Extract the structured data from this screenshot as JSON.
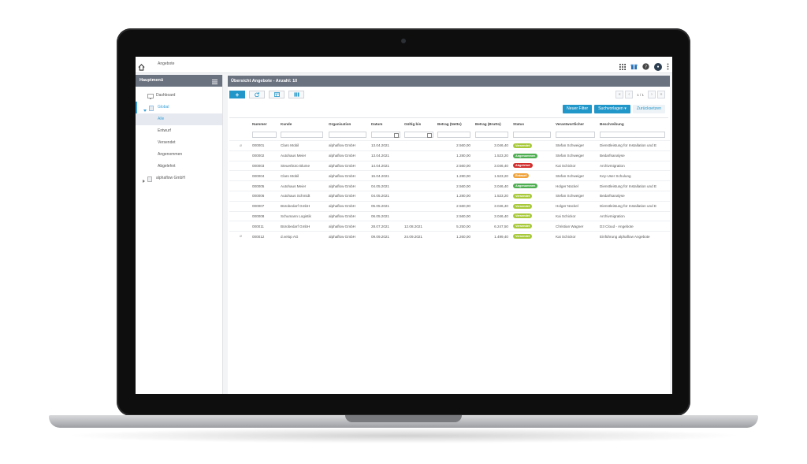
{
  "topbar": {
    "breadcrumb": "Angebote"
  },
  "sidebar": {
    "title": "Hauptmenü",
    "items": [
      {
        "label": "Dashboard",
        "level": 0
      },
      {
        "label": "Global",
        "level": 0
      },
      {
        "label": "Alle",
        "level": 1,
        "active": true
      },
      {
        "label": "Entwurf",
        "level": 1
      },
      {
        "label": "Versendet",
        "level": 1
      },
      {
        "label": "Angenommen",
        "level": 1
      },
      {
        "label": "Abgelehnt",
        "level": 1
      },
      {
        "label": "alphaflow GmbH",
        "level": 0
      }
    ]
  },
  "main": {
    "title": "Übersicht Angebote - Anzahl: 10",
    "pager": {
      "text": "1 / 1"
    },
    "filter_buttons": {
      "new": "Neuer Filter",
      "templates": "Suchvorlagen ▾",
      "reset": "Zurücksetzen"
    }
  },
  "table": {
    "columns": [
      "",
      "Nummer",
      "Kunde",
      "Organisation",
      "Datum",
      "Gültig bis",
      "Betrag (Netto)",
      "Betrag (Brutto)",
      "Status",
      "Verantwortlicher",
      "Beschreibung"
    ],
    "rows": [
      {
        "attach": true,
        "nummer": "000001",
        "kunde": "Claro Mobil",
        "org": "alphaflow GmbH",
        "datum": "13.04.2021",
        "gueltig": "",
        "netto": "2.560,00",
        "brutto": "3.046,40",
        "status": "Versendet",
        "verantw": "Stefan Schweiger",
        "beschr": "Dienstleistung für Installation und E"
      },
      {
        "attach": false,
        "nummer": "000002",
        "kunde": "Autohaus Meier",
        "org": "alphaflow GmbH",
        "datum": "13.04.2021",
        "gueltig": "",
        "netto": "1.280,00",
        "brutto": "1.523,20",
        "status": "Angenommen",
        "verantw": "Stefan Schweiger",
        "beschr": "Bedarfsanalyse"
      },
      {
        "attach": false,
        "nummer": "000003",
        "kunde": "Steuerbüro Blume",
        "org": "alphaflow GmbH",
        "datum": "14.04.2021",
        "gueltig": "",
        "netto": "2.560,00",
        "brutto": "3.046,40",
        "status": "Abgelehnt",
        "verantw": "Kai Schickor",
        "beschr": "Archivmigration"
      },
      {
        "attach": false,
        "nummer": "000004",
        "kunde": "Claro Mobil",
        "org": "alphaflow GmbH",
        "datum": "15.04.2021",
        "gueltig": "",
        "netto": "1.280,00",
        "brutto": "1.523,20",
        "status": "Entwurf",
        "verantw": "Stefan Schweiger",
        "beschr": "Key-User Schulung"
      },
      {
        "attach": false,
        "nummer": "000005",
        "kunde": "Autohaus Meier",
        "org": "alphaflow GmbH",
        "datum": "04.05.2021",
        "gueltig": "",
        "netto": "2.560,00",
        "brutto": "3.046,40",
        "status": "Angenommen",
        "verantw": "Holger Nückel",
        "beschr": "Dienstleistung für Installation und E"
      },
      {
        "attach": false,
        "nummer": "000006",
        "kunde": "Autohaus Schmidt",
        "org": "alphaflow GmbH",
        "datum": "04.05.2021",
        "gueltig": "",
        "netto": "1.280,00",
        "brutto": "1.523,20",
        "status": "Versendet",
        "verantw": "Stefan Schweiger",
        "beschr": "Bedarfsanalyse"
      },
      {
        "attach": false,
        "nummer": "000007",
        "kunde": "Bürobedarf GmbH",
        "org": "alphaflow GmbH",
        "datum": "05.05.2021",
        "gueltig": "",
        "netto": "2.560,00",
        "brutto": "3.046,40",
        "status": "Versendet",
        "verantw": "Holger Nückel",
        "beschr": "Dienstleistung für Installation und E"
      },
      {
        "attach": false,
        "nummer": "000008",
        "kunde": "Schumann Logistik",
        "org": "alphaflow GmbH",
        "datum": "06.05.2021",
        "gueltig": "",
        "netto": "2.560,00",
        "brutto": "3.046,40",
        "status": "Versendet",
        "verantw": "Kai Schickor",
        "beschr": "Archivmigration"
      },
      {
        "attach": false,
        "nummer": "000011",
        "kunde": "Bürobedarf GmbH",
        "org": "alphaflow GmbH",
        "datum": "28.07.2021",
        "gueltig": "12.08.2021",
        "netto": "5.250,00",
        "brutto": "6.247,50",
        "status": "Versendet",
        "verantw": "Christian Wagner",
        "beschr": "D3 Cloud - Angebote"
      },
      {
        "attach": true,
        "nummer": "000012",
        "kunde": "d.velop AG",
        "org": "alphaflow GmbH",
        "datum": "09.09.2021",
        "gueltig": "24.09.2021",
        "netto": "1.260,00",
        "brutto": "1.499,40",
        "status": "Versendet",
        "verantw": "Kai Schickor",
        "beschr": "Einführung alphaflow Angebote"
      }
    ]
  },
  "status_colors": {
    "Versendet": "#a8c93a",
    "Angenommen": "#4cae4f",
    "Abgelehnt": "#d32f2f",
    "Entwurf": "#f0a33a"
  },
  "icons": [
    "home-icon",
    "apps-grid-icon",
    "gift-icon",
    "help-icon",
    "avatar",
    "more-vert-icon",
    "menu-icon",
    "dashboard-icon",
    "folder-icon",
    "add-icon",
    "refresh-icon",
    "table-icon",
    "columns-icon",
    "attachment-icon",
    "calendar-icon"
  ]
}
